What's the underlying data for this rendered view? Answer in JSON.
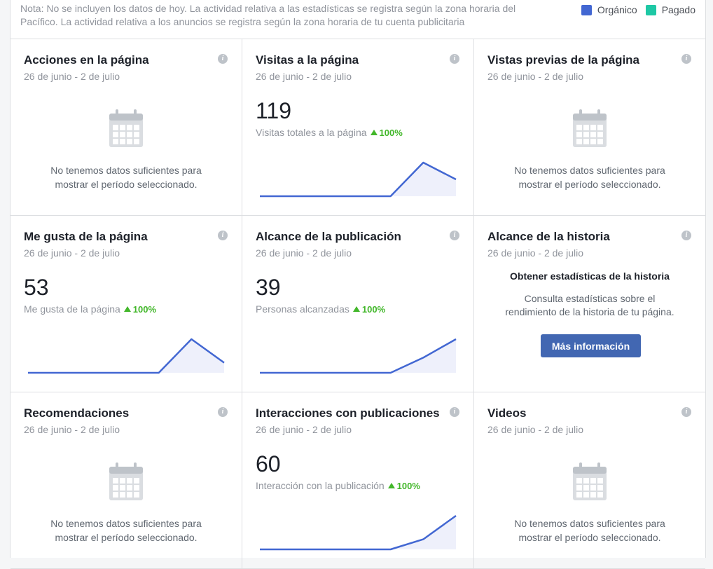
{
  "header": {
    "note": "Nota: No se incluyen los datos de hoy. La actividad relativa a las estadísticas se registra según la zona horaria del Pacífico. La actividad relativa a los anuncios se registra según la zona horaria de tu cuenta publicitaria",
    "legend": [
      {
        "label": "Orgánico",
        "color": "#4267d2"
      },
      {
        "label": "Pagado",
        "color": "#1ec8a5"
      }
    ]
  },
  "colors": {
    "line": "#4267d2",
    "fill": "#eef0fb",
    "positive": "#42b72a",
    "button": "#4267b2"
  },
  "cards": {
    "acciones": {
      "title": "Acciones en la página",
      "date": "26 de junio - 2 de julio",
      "nodata_1": "No tenemos datos suficientes para",
      "nodata_2": "mostrar el período seleccionado."
    },
    "visitas": {
      "title": "Visitas a la página",
      "date": "26 de junio - 2 de julio",
      "value": "119",
      "label": "Visitas totales a la página",
      "change": "100%",
      "trend": [
        0,
        0,
        0,
        0,
        0,
        1,
        0.5
      ]
    },
    "vistas_previas": {
      "title": "Vistas previas de la página",
      "date": "26 de junio - 2 de julio",
      "nodata_1": "No tenemos datos suficientes para",
      "nodata_2": "mostrar el período seleccionado."
    },
    "me_gusta": {
      "title": "Me gusta de la página",
      "date": "26 de junio - 2 de julio",
      "value": "53",
      "label": "Me gusta de la página",
      "change": "100%",
      "trend": [
        0,
        0,
        0,
        0,
        0,
        1,
        0.3
      ]
    },
    "alcance_pub": {
      "title": "Alcance de la publicación",
      "date": "26 de junio - 2 de julio",
      "value": "39",
      "label": "Personas alcanzadas",
      "change": "100%",
      "trend": [
        0,
        0,
        0,
        0,
        0,
        0.45,
        1
      ]
    },
    "alcance_historia": {
      "title": "Alcance de la historia",
      "date": "26 de junio - 2 de julio",
      "heading": "Obtener estadísticas de la historia",
      "desc_1": "Consulta estadísticas sobre el",
      "desc_2": "rendimiento de la historia de tu página.",
      "button": "Más información"
    },
    "recomendaciones": {
      "title": "Recomendaciones",
      "date": "26 de junio - 2 de julio",
      "nodata_1": "No tenemos datos suficientes para",
      "nodata_2": "mostrar el período seleccionado."
    },
    "interacciones": {
      "title": "Interacciones con publicaciones",
      "date": "26 de junio - 2 de julio",
      "value": "60",
      "label": "Interacción con la publicación",
      "change": "100%",
      "trend": [
        0,
        0,
        0,
        0,
        0,
        0.3,
        1
      ]
    },
    "videos": {
      "title": "Videos",
      "date": "26 de junio - 2 de julio",
      "nodata_1": "No tenemos datos suficientes para",
      "nodata_2": "mostrar el período seleccionado."
    }
  }
}
